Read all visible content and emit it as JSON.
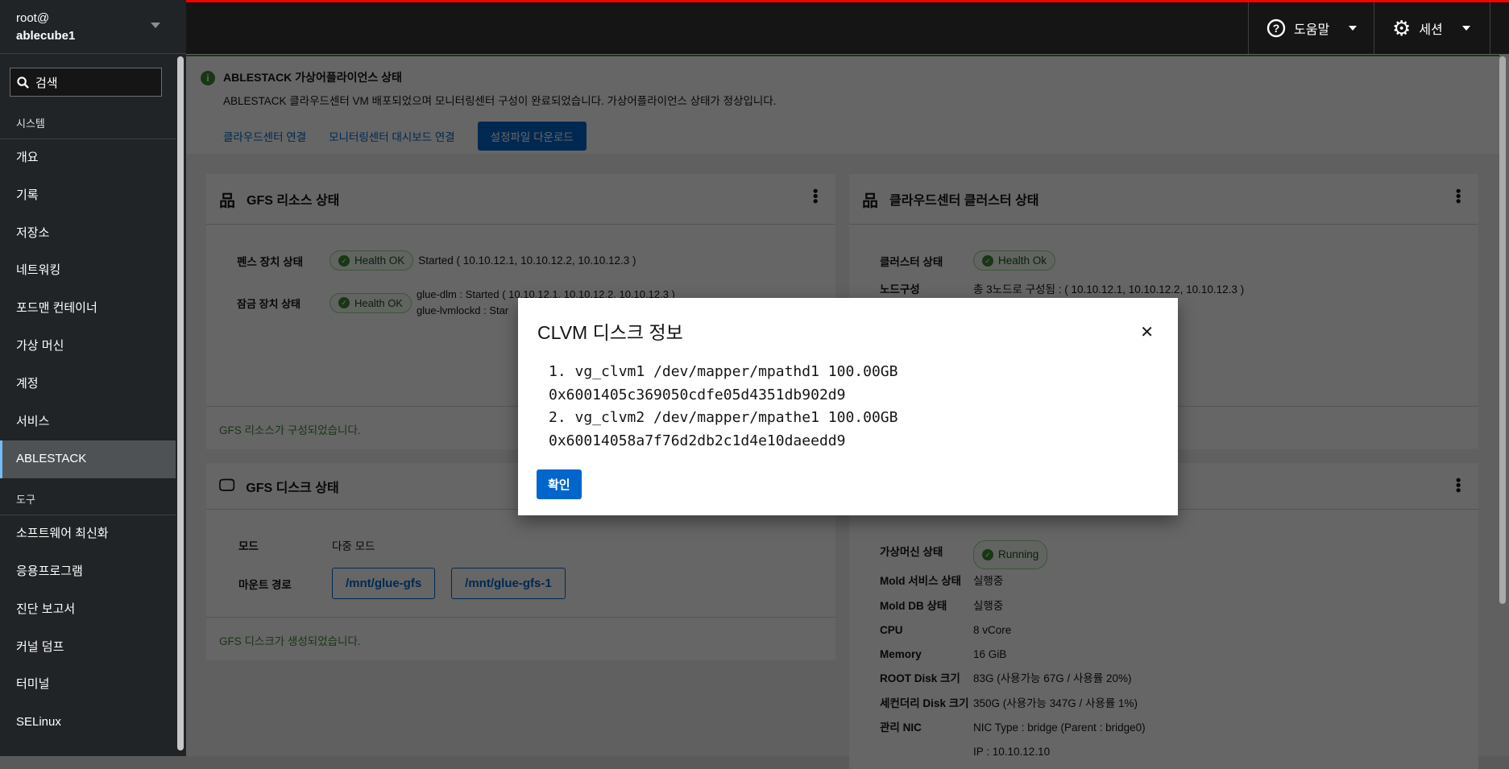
{
  "sidebar": {
    "user": "root@",
    "host": "ablecube1",
    "search_placeholder": "검색",
    "system_section": "시스템",
    "system_items": [
      "개요",
      "기록",
      "저장소",
      "네트워킹",
      "포드맨 컨테이너",
      "가상 머신",
      "계정",
      "서비스",
      "ABLESTACK"
    ],
    "tools_section": "도구",
    "tools_items": [
      "소프트웨어 최신화",
      "응용프로그램",
      "진단 보고서",
      "커널 덤프",
      "터미널",
      "SELinux"
    ],
    "active": "ABLESTACK"
  },
  "header": {
    "help": "도움말",
    "session": "세션"
  },
  "alert": {
    "title": "ABLESTACK 가상어플라이언스 상태",
    "text": "ABLESTACK 클라우드센터 VM 배포되었으며 모니터링센터 구성이 완료되었습니다. 가상어플라이언스 상태가 정상입니다.",
    "link1": "클라우드센터 연결",
    "link2": "모니터링센터 대시보드 연결",
    "button": "설정파일 다운로드"
  },
  "gfs_resource": {
    "title": "GFS 리소스 상태",
    "fence_label": "펜스 장치 상태",
    "fence_badge": "Health OK",
    "fence_value": "Started ( 10.10.12.1, 10.10.12.2, 10.10.12.3 )",
    "lock_label": "잠금 장치 상태",
    "lock_badge": "Health OK",
    "lock_value1": "glue-dlm : Started ( 10.10.12.1, 10.10.12.2, 10.10.12.3 )",
    "lock_value2": "glue-lvmlockd : Star",
    "footer": "GFS 리소스가 구성되었습니다."
  },
  "cluster": {
    "title": "클라우드센터 클러스터 상태",
    "status_label": "클러스터 상태",
    "status_badge": "Health Ok",
    "node_label": "노드구성",
    "node_value": "총 3노드로 구성됨 : ( 10.10.12.1, 10.10.12.2, 10.10.12.3 )"
  },
  "gfs_disk": {
    "title": "GFS 디스크 상태",
    "mode_label": "모드",
    "mode_value": "다중 모드",
    "mount_label": "마운트 경로",
    "mounts": [
      "/mnt/glue-gfs",
      "/mnt/glue-gfs-1"
    ],
    "footer": "GFS 디스크가 생성되었습니다."
  },
  "vm": {
    "rows": [
      {
        "label": "가상머신 상태",
        "value": "Running"
      },
      {
        "label": "Mold 서비스 상태",
        "value": "실행중"
      },
      {
        "label": "Mold DB 상태",
        "value": "실행중"
      },
      {
        "label": "CPU",
        "value": "8 vCore"
      },
      {
        "label": "Memory",
        "value": "16 GiB"
      },
      {
        "label": "ROOT Disk 크기",
        "value": "83G (사용가능 67G / 사용률 20%)"
      },
      {
        "label": "세컨더리 Disk 크기",
        "value": "350G (사용가능 347G / 사용률 1%)"
      },
      {
        "label": "관리 NIC",
        "value": "NIC Type : bridge (Parent : bridge0)"
      },
      {
        "label": "",
        "value": "IP : 10.10.12.10"
      }
    ]
  },
  "modal": {
    "title": "CLVM 디스크 정보",
    "lines": [
      "1. vg_clvm1 /dev/mapper/mpathd1 100.00GB",
      "0x6001405c369050cdfe05d4351db902d9",
      "2. vg_clvm2 /dev/mapper/mpathe1 100.00GB",
      "0x60014058a7f76d2db2c1d4e10daeedd9"
    ],
    "ok": "확인"
  }
}
